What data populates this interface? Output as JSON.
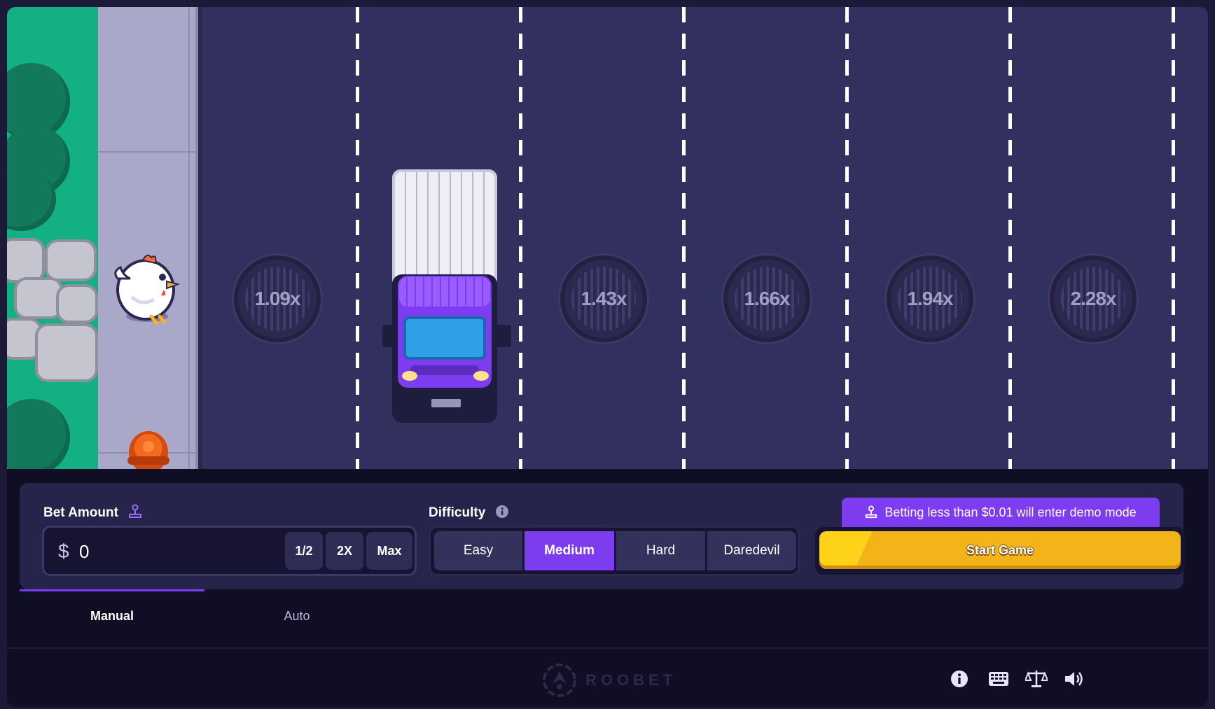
{
  "game": {
    "multipliers": [
      {
        "label": "1.09x"
      },
      {
        "label": "1.43x"
      },
      {
        "label": "1.66x"
      },
      {
        "label": "1.94x"
      },
      {
        "label": "2.28x"
      }
    ]
  },
  "controls": {
    "bet": {
      "label": "Bet Amount",
      "currency": "$",
      "value": "0",
      "half_label": "1/2",
      "double_label": "2X",
      "max_label": "Max"
    },
    "difficulty": {
      "label": "Difficulty",
      "options": [
        "Easy",
        "Medium",
        "Hard",
        "Daredevil"
      ],
      "selected": "Medium"
    },
    "demo_note": "Betting less than $0.01 will enter demo mode",
    "start_label": "Start Game"
  },
  "tabs": [
    {
      "label": "Manual",
      "active": true
    },
    {
      "label": "Auto",
      "active": false
    }
  ],
  "footer": {
    "brand": "ROOBET",
    "icons": [
      "info-icon",
      "keyboard-icon",
      "fairness-scale-icon",
      "volume-icon"
    ]
  },
  "colors": {
    "accent": "#7d3cf0",
    "road": "#32305e",
    "start_button": "#f2b418",
    "grass": "#12b083"
  }
}
